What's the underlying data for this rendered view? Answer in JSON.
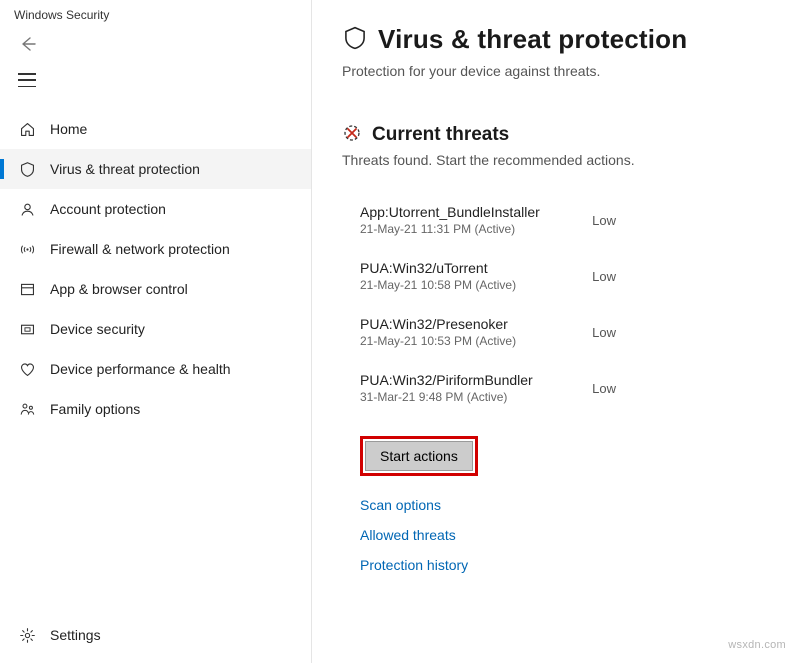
{
  "window_title": "Windows Security",
  "sidebar": {
    "items": [
      {
        "label": "Home"
      },
      {
        "label": "Virus & threat protection"
      },
      {
        "label": "Account protection"
      },
      {
        "label": "Firewall & network protection"
      },
      {
        "label": "App & browser control"
      },
      {
        "label": "Device security"
      },
      {
        "label": "Device performance & health"
      },
      {
        "label": "Family options"
      }
    ],
    "settings_label": "Settings"
  },
  "page": {
    "title": "Virus & threat protection",
    "subtitle": "Protection for your device against threats."
  },
  "current_threats": {
    "heading": "Current threats",
    "subtitle": "Threats found. Start the recommended actions.",
    "items": [
      {
        "name": "App:Utorrent_BundleInstaller",
        "meta": "21-May-21 11:31 PM (Active)",
        "severity": "Low"
      },
      {
        "name": "PUA:Win32/uTorrent",
        "meta": "21-May-21 10:58 PM (Active)",
        "severity": "Low"
      },
      {
        "name": "PUA:Win32/Presenoker",
        "meta": "21-May-21 10:53 PM (Active)",
        "severity": "Low"
      },
      {
        "name": "PUA:Win32/PiriformBundler",
        "meta": "31-Mar-21 9:48 PM (Active)",
        "severity": "Low"
      }
    ],
    "start_actions_label": "Start actions"
  },
  "links": {
    "scan_options": "Scan options",
    "allowed_threats": "Allowed threats",
    "protection_history": "Protection history"
  },
  "watermark": "wsxdn.com"
}
